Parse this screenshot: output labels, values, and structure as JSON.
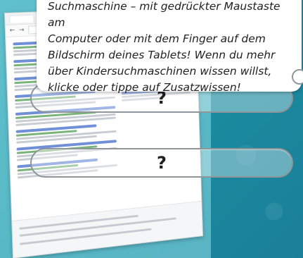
{
  "tooltip": {
    "lines": [
      "Suchmaschine – mit gedrückter Maustaste am",
      "Computer oder mit dem Finger auf dem",
      "Bildschirm deines Tablets! Wenn du mehr",
      "über Kindersuchmaschinen wissen willst,",
      "klicke oder tippe auf Zusatzwissen!"
    ]
  },
  "questions": [
    {
      "label": "?"
    },
    {
      "label": "?"
    }
  ],
  "icons": {
    "tooltip_edge": "circle-icon"
  }
}
